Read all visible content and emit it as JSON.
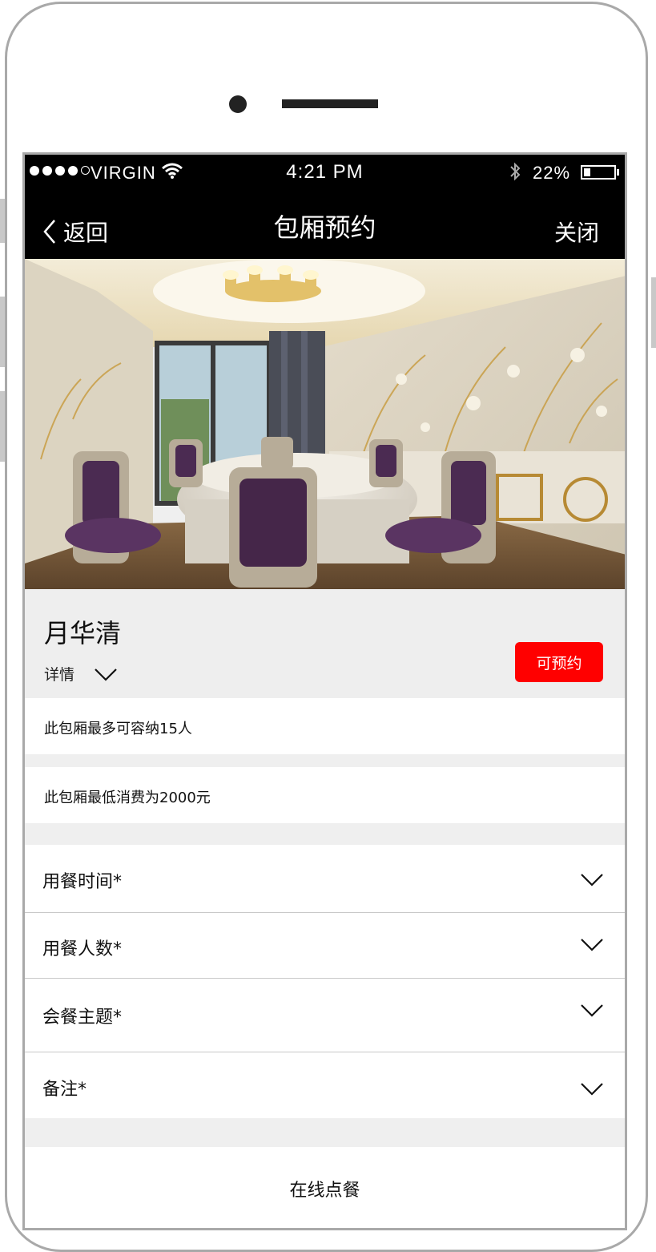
{
  "status_bar": {
    "carrier": "VIRGIN",
    "time": "4:21 PM",
    "battery": "22%",
    "battery_level": 0.22,
    "icons": [
      "signal-dots-icon",
      "wifi-icon",
      "bluetooth-icon",
      "battery-icon"
    ]
  },
  "nav": {
    "back_label": "返回",
    "title": "包厢预约",
    "close_label": "关闭"
  },
  "room": {
    "name": "月华清",
    "details_label": "详情",
    "reserve_label": "可预约",
    "capacity_text": "此包厢最多可容纳15人",
    "min_spend_text": "此包厢最低消费为2000元"
  },
  "form": {
    "fields": [
      {
        "label": "用餐时间*"
      },
      {
        "label": "用餐人数*"
      },
      {
        "label": "会餐主题*"
      },
      {
        "label": "备注*"
      }
    ]
  },
  "footer": {
    "order_label": "在线点餐"
  },
  "colors": {
    "accent": "#ff0000",
    "header_bg": "#000000",
    "panel_bg": "#eeeeee"
  }
}
